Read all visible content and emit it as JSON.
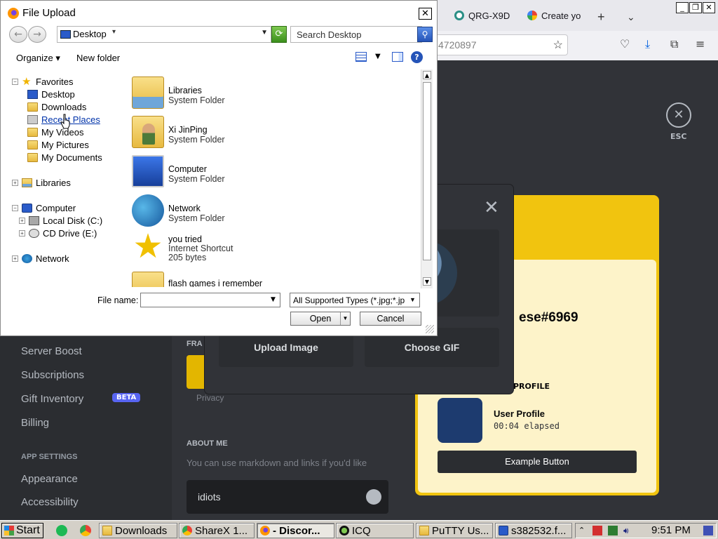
{
  "browser": {
    "tabs": [
      {
        "label": "QRG-X9D"
      },
      {
        "label": "Create yo"
      }
    ],
    "new_tab_glyph": "+",
    "tab_list_glyph": "⌄",
    "url_fragment": "4720897",
    "window_buttons": {
      "minimize": "_",
      "restore": "❐",
      "close": "✕"
    }
  },
  "discord": {
    "nav_items": [
      "Server Boost",
      "Subscriptions",
      "Gift Inventory",
      "Billing",
      "Appearance",
      "Accessibility"
    ],
    "beta_badge": "BETA",
    "app_settings_heading": "APP SETTINGS",
    "esc_label": "ESC",
    "esc_glyph": "✕",
    "section_prefix": "FRA",
    "privacy_fragment": "Privacy",
    "about_me_heading": "ABOUT ME",
    "about_me_hint": "You can use markdown and links if you'd like",
    "about_me_value": "idiots",
    "profile": {
      "username_fragment": "ese#6969",
      "section_heading": "PROFILE",
      "app_title": "User Profile",
      "app_elapsed": "00:04 elapsed",
      "button": "Example Button"
    },
    "modal": {
      "close_glyph": "✕",
      "upload_image": "Upload Image",
      "choose_gif": "Choose GIF"
    }
  },
  "file_dialog": {
    "title": "File Upload",
    "close_glyph": "✕",
    "address": "Desktop",
    "search_placeholder": "Search Desktop",
    "toolbar": {
      "organize": "Organize",
      "new_folder": "New folder",
      "help": "?"
    },
    "tree": {
      "favorites": "Favorites",
      "favorites_children": [
        "Desktop",
        "Downloads",
        "Recent Places",
        "My Videos",
        "My Pictures",
        "My Documents"
      ],
      "libraries": "Libraries",
      "computer": "Computer",
      "computer_children": [
        "Local Disk (C:)",
        "CD Drive (E:)"
      ],
      "network": "Network"
    },
    "items": [
      {
        "name": "Libraries",
        "type": "System Folder"
      },
      {
        "name": "Xi JinPing",
        "type": "System Folder"
      },
      {
        "name": "Computer",
        "type": "System Folder"
      },
      {
        "name": "Network",
        "type": "System Folder"
      },
      {
        "name": "you tried",
        "type": "Internet Shortcut",
        "size": "205 bytes"
      },
      {
        "name": "flash games i remember",
        "type": ""
      }
    ],
    "file_name_label": "File name:",
    "file_name_value": "",
    "file_type": "All Supported Types (*.jpg;*.jp",
    "open_label": "Open",
    "cancel_label": "Cancel"
  },
  "taskbar": {
    "start": "Start",
    "tasks": [
      "Downloads",
      "ShareX 1...",
      "- Discor...",
      "ICQ",
      "PuTTY Us...",
      "s382532.f..."
    ],
    "clock": "9:51 PM"
  },
  "colors": {
    "discord_bg": "#313338",
    "discord_sidebar": "#2b2d31",
    "profile_yellow": "#f1c40f",
    "blurple": "#5865f2",
    "taskbar": "#d4d0c8"
  }
}
